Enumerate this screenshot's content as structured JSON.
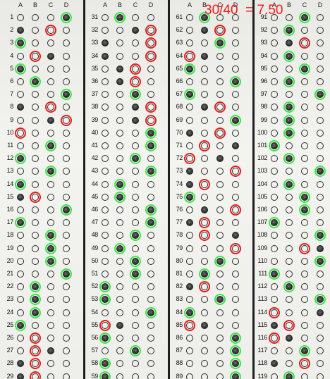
{
  "score_text": "30/40  = 7.50",
  "colors": {
    "correct": "#39e64a",
    "wrong": "#e61c1c",
    "mark": "#2b2b2b"
  },
  "choices": [
    "A",
    "B",
    "C",
    "D"
  ],
  "columns": [
    {
      "start": 1,
      "rows": [
        {
          "n": "1",
          "filled": "D",
          "ring": "D",
          "status": "correct"
        },
        {
          "n": "2",
          "filled": "A",
          "ring": "C",
          "status": "wrong"
        },
        {
          "n": "3",
          "filled": "A",
          "ring": "A",
          "status": "correct"
        },
        {
          "n": "4",
          "filled": "C",
          "ring": "B",
          "status": "wrong"
        },
        {
          "n": "5",
          "filled": "A",
          "ring": "A",
          "status": "correct"
        },
        {
          "n": "6",
          "filled": "B",
          "ring": "B",
          "status": "correct"
        },
        {
          "n": "7",
          "filled": "D",
          "ring": "D",
          "status": "correct"
        },
        {
          "n": "8",
          "filled": "A",
          "ring": "C",
          "status": "wrong"
        },
        {
          "n": "9",
          "filled": "C",
          "ring": "D",
          "status": "wrong"
        },
        {
          "n": "10",
          "filled": "",
          "ring": "A",
          "status": "wrong"
        },
        {
          "n": "11",
          "filled": "C",
          "ring": "C",
          "status": "correct"
        },
        {
          "n": "12",
          "filled": "A",
          "ring": "A",
          "status": "correct"
        },
        {
          "n": "13",
          "filled": "C",
          "ring": "C",
          "status": "correct"
        },
        {
          "n": "14",
          "filled": "A",
          "ring": "A",
          "status": "correct"
        },
        {
          "n": "15",
          "filled": "A",
          "ring": "B",
          "status": "wrong"
        },
        {
          "n": "16",
          "filled": "D",
          "ring": "D",
          "status": "correct"
        },
        {
          "n": "17",
          "filled": "A",
          "ring": "A",
          "status": "correct"
        },
        {
          "n": "18",
          "filled": "C",
          "ring": "C",
          "status": "correct"
        },
        {
          "n": "19",
          "filled": "C",
          "ring": "C",
          "status": "correct"
        },
        {
          "n": "20",
          "filled": "C",
          "ring": "C",
          "status": "correct"
        },
        {
          "n": "21",
          "filled": "D",
          "ring": "D",
          "status": "correct"
        },
        {
          "n": "22",
          "filled": "B",
          "ring": "B",
          "status": "correct"
        },
        {
          "n": "23",
          "filled": "B",
          "ring": "B",
          "status": "correct"
        },
        {
          "n": "24",
          "filled": "B",
          "ring": "B",
          "status": "correct"
        },
        {
          "n": "25",
          "filled": "A",
          "ring": "A",
          "status": "correct"
        },
        {
          "n": "26",
          "filled": "",
          "ring": "B",
          "status": "wrong"
        },
        {
          "n": "27",
          "filled": "C",
          "ring": "B",
          "status": "wrong"
        },
        {
          "n": "28",
          "filled": "A",
          "ring": "B",
          "status": "wrong"
        },
        {
          "n": "29",
          "filled": "A",
          "ring": "B",
          "status": "wrong"
        }
      ]
    },
    {
      "start": 31,
      "rows": [
        {
          "n": "31",
          "filled": "B",
          "ring": "B",
          "status": "correct"
        },
        {
          "n": "32",
          "filled": "C",
          "ring": "D",
          "status": "wrong"
        },
        {
          "n": "33",
          "filled": "A",
          "ring": "D",
          "status": "wrong"
        },
        {
          "n": "34",
          "filled": "A",
          "ring": "D",
          "status": "wrong"
        },
        {
          "n": "35",
          "filled": "B",
          "ring": "C",
          "status": "wrong"
        },
        {
          "n": "36",
          "filled": "B",
          "ring": "C",
          "status": "wrong"
        },
        {
          "n": "37",
          "filled": "C",
          "ring": "C",
          "status": "correct"
        },
        {
          "n": "38",
          "filled": "C",
          "ring": "D",
          "status": "wrong"
        },
        {
          "n": "39",
          "filled": "C",
          "ring": "D",
          "status": "wrong"
        },
        {
          "n": "40",
          "filled": "D",
          "ring": "D",
          "status": "correct"
        },
        {
          "n": "41",
          "filled": "D",
          "ring": "D",
          "status": "correct"
        },
        {
          "n": "42",
          "filled": "C",
          "ring": "C",
          "status": "correct"
        },
        {
          "n": "43",
          "filled": "D",
          "ring": "D",
          "status": "correct"
        },
        {
          "n": "44",
          "filled": "B",
          "ring": "B",
          "status": "correct"
        },
        {
          "n": "45",
          "filled": "B",
          "ring": "B",
          "status": "correct"
        },
        {
          "n": "46",
          "filled": "D",
          "ring": "D",
          "status": "correct"
        },
        {
          "n": "47",
          "filled": "D",
          "ring": "D",
          "status": "correct"
        },
        {
          "n": "48",
          "filled": "C",
          "ring": "C",
          "status": "correct"
        },
        {
          "n": "49",
          "filled": "B",
          "ring": "B",
          "status": "correct"
        },
        {
          "n": "50",
          "filled": "C",
          "ring": "C",
          "status": "correct"
        },
        {
          "n": "51",
          "filled": "C",
          "ring": "C",
          "status": "correct"
        },
        {
          "n": "52",
          "filled": "A",
          "ring": "A",
          "status": "correct"
        },
        {
          "n": "53",
          "filled": "A",
          "ring": "A",
          "status": "correct"
        },
        {
          "n": "54",
          "filled": "D",
          "ring": "D",
          "status": "correct"
        },
        {
          "n": "55",
          "filled": "B",
          "ring": "A",
          "status": "wrong"
        },
        {
          "n": "56",
          "filled": "A",
          "ring": "A",
          "status": "correct"
        },
        {
          "n": "57",
          "filled": "C",
          "ring": "C",
          "status": "correct"
        },
        {
          "n": "58",
          "filled": "A",
          "ring": "A",
          "status": "correct"
        },
        {
          "n": "59",
          "filled": "A",
          "ring": "A",
          "status": "correct"
        }
      ]
    },
    {
      "start": 61,
      "rows": [
        {
          "n": "61",
          "filled": "B",
          "ring": "B",
          "status": "correct"
        },
        {
          "n": "62",
          "filled": "B",
          "ring": "C",
          "status": "wrong"
        },
        {
          "n": "63",
          "filled": "C",
          "ring": "C",
          "status": "correct"
        },
        {
          "n": "64",
          "filled": "B",
          "ring": "A",
          "status": "wrong"
        },
        {
          "n": "65",
          "filled": "A",
          "ring": "A",
          "status": "correct"
        },
        {
          "n": "66",
          "filled": "D",
          "ring": "D",
          "status": "correct"
        },
        {
          "n": "67",
          "filled": "A",
          "ring": "A",
          "status": "correct"
        },
        {
          "n": "68",
          "filled": "B",
          "ring": "C",
          "status": "wrong"
        },
        {
          "n": "69",
          "filled": "D",
          "ring": "D",
          "status": "correct"
        },
        {
          "n": "70",
          "filled": "A",
          "ring": "C",
          "status": "wrong"
        },
        {
          "n": "71",
          "filled": "D",
          "ring": "B",
          "status": "wrong"
        },
        {
          "n": "72",
          "filled": "C",
          "ring": "A",
          "status": "wrong"
        },
        {
          "n": "73",
          "filled": "A",
          "ring": "D",
          "status": "wrong"
        },
        {
          "n": "74",
          "filled": "A",
          "ring": "B",
          "status": "wrong"
        },
        {
          "n": "75",
          "filled": "A",
          "ring": "A",
          "status": "correct"
        },
        {
          "n": "76",
          "filled": "B",
          "ring": "D",
          "status": "wrong"
        },
        {
          "n": "77",
          "filled": "A",
          "ring": "B",
          "status": "wrong"
        },
        {
          "n": "78",
          "filled": "D",
          "ring": "B",
          "status": "wrong"
        },
        {
          "n": "79",
          "filled": "",
          "ring": "D",
          "status": "wrong"
        },
        {
          "n": "80",
          "filled": "C",
          "ring": "C",
          "status": "correct"
        },
        {
          "n": "81",
          "filled": "B",
          "ring": "B",
          "status": "correct"
        },
        {
          "n": "82",
          "filled": "A",
          "ring": "B",
          "status": "wrong"
        },
        {
          "n": "83",
          "filled": "C",
          "ring": "C",
          "status": "correct"
        },
        {
          "n": "84",
          "filled": "A",
          "ring": "A",
          "status": "correct"
        },
        {
          "n": "85",
          "filled": "B",
          "ring": "A",
          "status": "wrong"
        },
        {
          "n": "86",
          "filled": "D",
          "ring": "D",
          "status": "correct"
        },
        {
          "n": "87",
          "filled": "D",
          "ring": "D",
          "status": "correct"
        },
        {
          "n": "88",
          "filled": "D",
          "ring": "D",
          "status": "correct"
        },
        {
          "n": "89",
          "filled": "D",
          "ring": "D",
          "status": "correct"
        }
      ]
    },
    {
      "start": 91,
      "rows": [
        {
          "n": "91",
          "filled": "C",
          "ring": "C",
          "status": "correct"
        },
        {
          "n": "92",
          "filled": "B",
          "ring": "B",
          "status": "correct"
        },
        {
          "n": "93",
          "filled": "B",
          "ring": "C",
          "status": "wrong"
        },
        {
          "n": "94",
          "filled": "B",
          "ring": "B",
          "status": "correct"
        },
        {
          "n": "95",
          "filled": "C",
          "ring": "C",
          "status": "correct"
        },
        {
          "n": "96",
          "filled": "B",
          "ring": "B",
          "status": "correct"
        },
        {
          "n": "97",
          "filled": "D",
          "ring": "D",
          "status": "correct"
        },
        {
          "n": "98",
          "filled": "B",
          "ring": "B",
          "status": "correct"
        },
        {
          "n": "99",
          "filled": "B",
          "ring": "B",
          "status": "correct"
        },
        {
          "n": "100",
          "filled": "B",
          "ring": "B",
          "status": "correct"
        },
        {
          "n": "101",
          "filled": "A",
          "ring": "A",
          "status": "correct"
        },
        {
          "n": "102",
          "filled": "B",
          "ring": "B",
          "status": "correct"
        },
        {
          "n": "103",
          "filled": "D",
          "ring": "D",
          "status": "correct"
        },
        {
          "n": "104",
          "filled": "B",
          "ring": "B",
          "status": "correct"
        },
        {
          "n": "105",
          "filled": "C",
          "ring": "C",
          "status": "correct"
        },
        {
          "n": "106",
          "filled": "C",
          "ring": "C",
          "status": "correct"
        },
        {
          "n": "107",
          "filled": "A",
          "ring": "A",
          "status": "correct"
        },
        {
          "n": "108",
          "filled": "D",
          "ring": "D",
          "status": "correct"
        },
        {
          "n": "109",
          "filled": "D",
          "ring": "C",
          "status": "wrong"
        },
        {
          "n": "110",
          "filled": "D",
          "ring": "D",
          "status": "correct"
        },
        {
          "n": "111",
          "filled": "A",
          "ring": "A",
          "status": "correct"
        },
        {
          "n": "112",
          "filled": "B",
          "ring": "B",
          "status": "correct"
        },
        {
          "n": "113",
          "filled": "D",
          "ring": "D",
          "status": "correct"
        },
        {
          "n": "114",
          "filled": "D",
          "ring": "A",
          "status": "wrong"
        },
        {
          "n": "115",
          "filled": "A",
          "ring": "B",
          "status": "wrong"
        },
        {
          "n": "116",
          "filled": "B",
          "ring": "A",
          "status": "wrong"
        },
        {
          "n": "117",
          "filled": "C",
          "ring": "C",
          "status": "correct"
        },
        {
          "n": "118",
          "filled": "A",
          "ring": "C",
          "status": "wrong"
        },
        {
          "n": "119",
          "filled": "B",
          "ring": "B",
          "status": "correct"
        }
      ]
    }
  ]
}
